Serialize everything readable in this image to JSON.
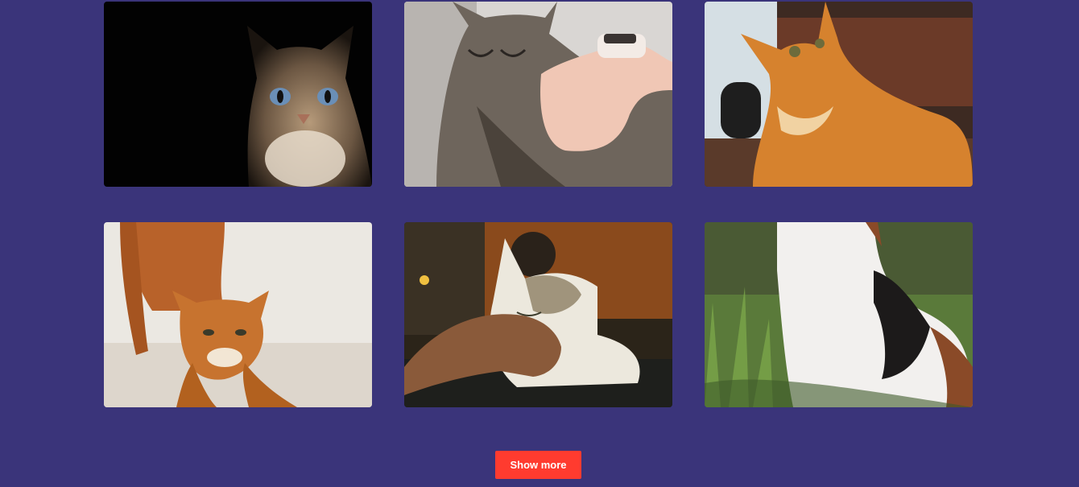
{
  "theme": {
    "background": "#3a347a",
    "button_color": "#ff3b2f"
  },
  "gallery": {
    "images": [
      {
        "name": "tabby-cat-blue-eyes-photo"
      },
      {
        "name": "sleeping-tabby-cat-photo"
      },
      {
        "name": "orange-cat-looking-up-photo"
      },
      {
        "name": "orange-cat-stretching-photo"
      },
      {
        "name": "cat-being-petted-photo"
      },
      {
        "name": "calico-cat-in-grass-photo"
      }
    ]
  },
  "actions": {
    "show_more_label": "Show more"
  }
}
